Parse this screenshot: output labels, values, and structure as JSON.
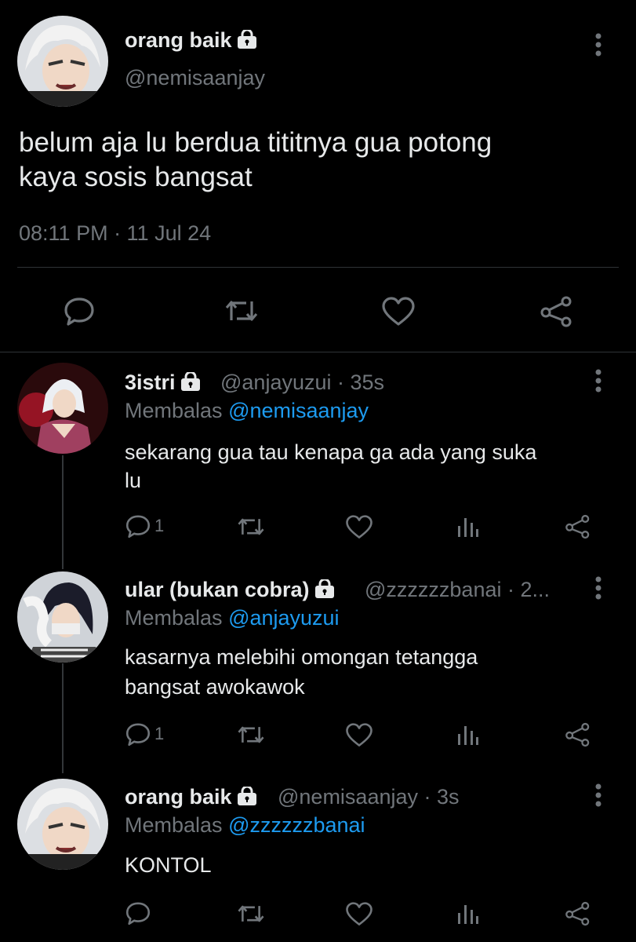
{
  "main_tweet": {
    "display_name": "orang baik",
    "handle": "@nemisaanjay",
    "text_line1": "belum aja lu berdua tititnya gua potong",
    "text_line2": "kaya sosis bangsat",
    "timestamp": "08:11 PM · 11 Jul 24",
    "actions": [
      "reply-icon",
      "retweet-icon",
      "like-icon",
      "share-icon"
    ]
  },
  "replies": [
    {
      "display_name": "3istri",
      "handle_time": "@anjayuzui · 35s",
      "replying_prefix": "Membalas",
      "replying_to": "@nemisaanjay",
      "text_line1": "sekarang gua tau kenapa ga ada yang suka",
      "text_line2": "lu",
      "reply_count": "1"
    },
    {
      "display_name": "ular (bukan cobra)",
      "handle_time": "@zzzzzzbanai · 2...",
      "replying_prefix": "Membalas",
      "replying_to": "@anjayuzui",
      "text_line1": "kasarnya melebihi omongan tetangga",
      "text_line2": "bangsat awokawok",
      "reply_count": "1"
    },
    {
      "display_name": "orang baik",
      "handle_time": "@nemisaanjay · 3s",
      "replying_prefix": "Membalas",
      "replying_to": "@zzzzzzbanai",
      "text_line1": "KONTOL",
      "reply_count": ""
    }
  ],
  "colors": {
    "background": "#000000",
    "text": "#e7e9ea",
    "muted": "#71767b",
    "mention": "#1d9bf0",
    "divider": "#2f3336"
  }
}
